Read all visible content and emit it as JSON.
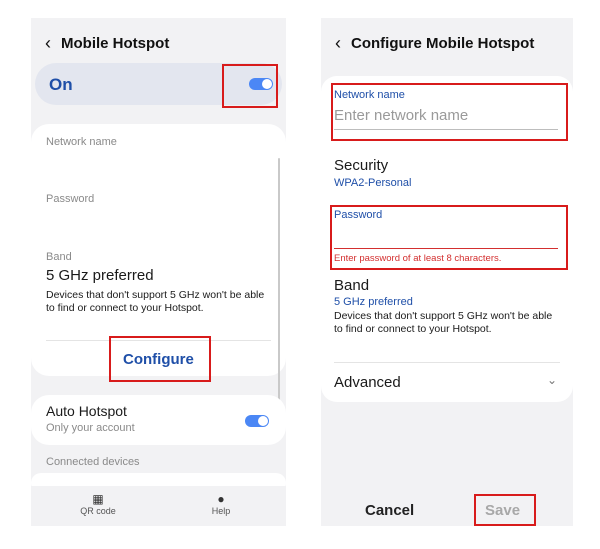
{
  "left": {
    "title": "Mobile Hotspot",
    "on_label": "On",
    "network_name_label": "Network name",
    "password_label": "Password",
    "band_label": "Band",
    "band_value": "5 GHz preferred",
    "band_desc": "Devices that don't support 5 GHz won't be able to find or connect to your Hotspot.",
    "configure_label": "Configure",
    "auto_hotspot_title": "Auto Hotspot",
    "auto_hotspot_sub": "Only your account",
    "connected_devices": "Connected devices",
    "nav": {
      "qr_label": "QR code",
      "help_label": "Help"
    }
  },
  "right": {
    "title": "Configure Mobile Hotspot",
    "network_name_label": "Network name",
    "network_name_placeholder": "Enter network name",
    "security_label": "Security",
    "security_value": "WPA2-Personal",
    "password_label": "Password",
    "password_error": "Enter password of at least 8 characters.",
    "band_label": "Band",
    "band_value": "5 GHz preferred",
    "band_desc": "Devices that don't support 5 GHz won't be able to find or connect to your Hotspot.",
    "advanced_label": "Advanced",
    "cancel_label": "Cancel",
    "save_label": "Save"
  },
  "colors": {
    "accent": "#1f4fa8",
    "toggle": "#4b87f5",
    "highlight": "#d81b1b",
    "error": "#d32f2f"
  }
}
